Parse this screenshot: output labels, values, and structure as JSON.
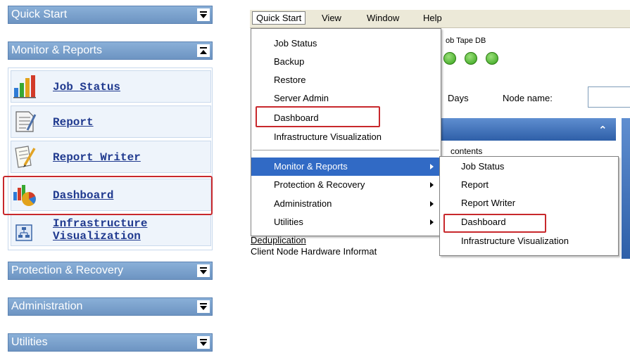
{
  "nav_panel": {
    "sections": [
      {
        "label": "Quick Start",
        "state": "collapsed"
      },
      {
        "label": "Monitor & Reports",
        "state": "expanded"
      },
      {
        "label": "Protection & Recovery",
        "state": "collapsed"
      },
      {
        "label": "Administration",
        "state": "collapsed"
      },
      {
        "label": "Utilities",
        "state": "collapsed"
      }
    ],
    "items": [
      {
        "label": "Job Status",
        "icon": "bar-chart-icon"
      },
      {
        "label": "Report",
        "icon": "report-icon"
      },
      {
        "label": "Report Writer",
        "icon": "report-writer-icon"
      },
      {
        "label": "Dashboard",
        "icon": "dashboard-icon",
        "highlighted": true
      },
      {
        "label_line1": "Infrastructure",
        "label_line2": "Visualization",
        "icon": "network-diagram-icon"
      }
    ]
  },
  "app_window": {
    "menubar": [
      "Quick Start",
      "View",
      "Window",
      "Help"
    ],
    "status_labels": "ob Tape DB",
    "days_label": "Days",
    "node_name_label": "Node name:",
    "background_fragments": [
      "contents",
      "Deduplication",
      "Client Node Hardware Informat"
    ],
    "quick_start_menu": [
      {
        "label": "Job Status"
      },
      {
        "label": "Backup"
      },
      {
        "label": "Restore"
      },
      {
        "label": "Server Admin"
      },
      {
        "label": "Dashboard",
        "highlighted": true
      },
      {
        "label": "Infrastructure Visualization"
      },
      {
        "label": "Monitor & Reports",
        "submenu": true,
        "selected": true
      },
      {
        "label": "Protection & Recovery",
        "submenu": true
      },
      {
        "label": "Administration",
        "submenu": true
      },
      {
        "label": "Utilities",
        "submenu": true
      }
    ],
    "monitor_submenu": [
      {
        "label": "Job Status"
      },
      {
        "label": "Report"
      },
      {
        "label": "Report Writer"
      },
      {
        "label": "Dashboard",
        "highlighted": true
      },
      {
        "label": "Infrastructure Visualization"
      }
    ]
  },
  "colors": {
    "highlight_border": "#c8282c",
    "header_blue": "#7aa2cf",
    "menu_selected": "#316ac5",
    "link_blue": "#203a8f"
  }
}
